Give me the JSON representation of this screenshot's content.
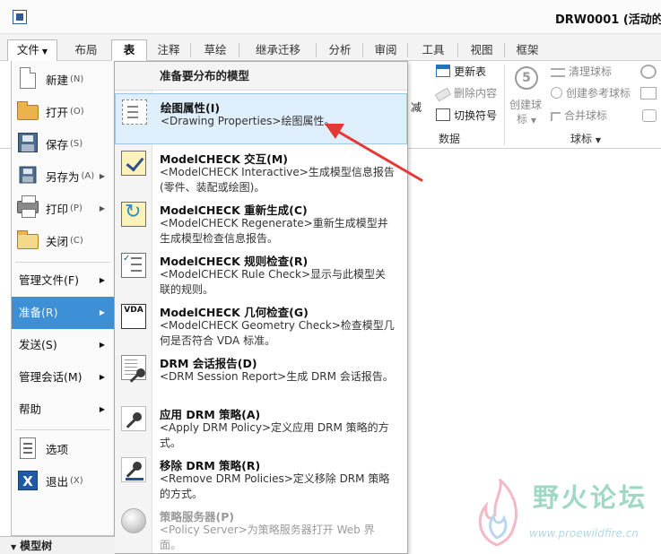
{
  "window": {
    "title": "DRW0001 (活动的"
  },
  "tabs": [
    {
      "label": "文件"
    },
    {
      "label": "布局"
    },
    {
      "label": "表"
    },
    {
      "label": "注释"
    },
    {
      "label": "草绘"
    },
    {
      "label": "继承迁移"
    },
    {
      "label": "分析"
    },
    {
      "label": "审阅"
    },
    {
      "label": "工具"
    },
    {
      "label": "视图"
    },
    {
      "label": "框架"
    }
  ],
  "ribbon": {
    "update_table": "更新表",
    "delete_content": "删除内容",
    "switch_symbol": "切换符号",
    "data_group": "数据",
    "create_balloon_line1": "创建球",
    "create_balloon_line2": "标",
    "clean_balloon": "清理球标",
    "create_ref_balloon": "创建参考球标",
    "merge_balloon": "合并球标",
    "balloon_group": "球标",
    "partial_left": "减"
  },
  "file_menu": {
    "items": [
      {
        "label": "新建",
        "hotkey": "(N)",
        "icon": "new-document-icon"
      },
      {
        "label": "打开",
        "hotkey": "(O)",
        "icon": "open-folder-icon"
      },
      {
        "label": "保存",
        "hotkey": "(S)",
        "icon": "save-floppy-icon"
      },
      {
        "label": "另存为",
        "hotkey": "(A)",
        "icon": "save-as-icon"
      },
      {
        "label": "打印",
        "hotkey": "(P)",
        "icon": "printer-icon"
      },
      {
        "label": "关闭",
        "hotkey": "(C)",
        "icon": "close-folder-icon"
      }
    ],
    "text_items": [
      {
        "label": "管理文件",
        "hotkey": "(F)"
      },
      {
        "label": "准备",
        "hotkey": "(R)"
      },
      {
        "label": "发送",
        "hotkey": "(S)"
      },
      {
        "label": "管理会话",
        "hotkey": "(M)"
      },
      {
        "label": "帮助",
        "hotkey": ""
      }
    ],
    "bottom_items": [
      {
        "label": "选项",
        "hotkey": "",
        "icon": "options-list-icon"
      },
      {
        "label": "退出",
        "hotkey": "(X)",
        "icon": "exit-x-icon"
      }
    ]
  },
  "submenu": {
    "header": "准备要分布的模型",
    "items": [
      {
        "title": "绘图属性(I)",
        "desc": "<Drawing Properties>绘图属性。",
        "icon": "drawing-properties-icon"
      },
      {
        "title": "ModelCHECK 交互(M)",
        "desc": "<ModelCHECK Interactive>生成模型信息报告 (零件、装配或绘图)。",
        "icon": "modelcheck-interactive-icon"
      },
      {
        "title": "ModelCHECK 重新生成(C)",
        "desc": "<ModelCHECK Regenerate>重新生成模型并生成模型检查信息报告。",
        "icon": "modelcheck-regenerate-icon"
      },
      {
        "title": "ModelCHECK 规则检查(R)",
        "desc": "<ModelCHECK Rule Check>显示与此模型关联的规则。",
        "icon": "modelcheck-rule-icon"
      },
      {
        "title": "ModelCHECK 几何检查(G)",
        "desc": "<ModelCHECK Geometry Check>检查模型几何是否符合 VDA 标准。",
        "icon": "vda-geometry-icon"
      },
      {
        "title": "DRM 会话报告(D)",
        "desc": "<DRM Session Report>生成 DRM 会话报告。",
        "icon": "drm-report-icon"
      },
      {
        "title": "应用 DRM 策略(A)",
        "desc": "<Apply DRM Policy>定义应用 DRM 策略的方式。",
        "icon": "apply-drm-key-icon"
      },
      {
        "title": "移除 DRM 策略(R)",
        "desc": "<Remove DRM Policies>定义移除 DRM 策略的方式。",
        "icon": "remove-drm-key-icon"
      },
      {
        "title": "策略服务器(P)",
        "desc": "<Policy Server>为策略服务器打开 Web 界面。",
        "icon": "policy-server-icon"
      }
    ],
    "vda_label": "VDA"
  },
  "bottom_strip": {
    "label": "模型树"
  },
  "watermark": {
    "text": "野火论坛",
    "url": "www.proewildfire.cn"
  },
  "colors": {
    "selected": "#3d8fd6",
    "highlight": "#dfeefb",
    "arrow": "#e53935"
  }
}
